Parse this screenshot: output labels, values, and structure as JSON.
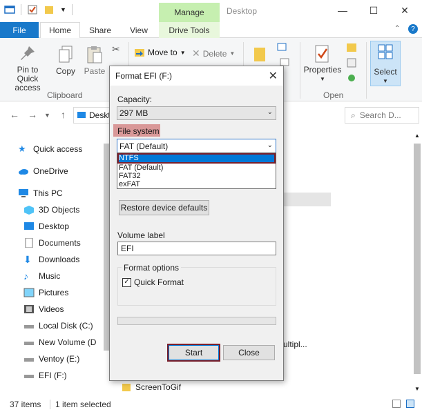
{
  "window": {
    "title": "Desktop",
    "manage_tab": "Manage",
    "minimize": "—",
    "maximize": "☐",
    "close": "✕"
  },
  "ribbon": {
    "tabs": [
      "File",
      "Home",
      "Share",
      "View",
      "Drive Tools"
    ],
    "buttons": {
      "pin": "Pin to Quick access",
      "copy": "Copy",
      "paste": "Paste",
      "move_to": "Move to",
      "delete": "Delete",
      "properties": "Properties",
      "select": "Select"
    },
    "groups": {
      "clipboard": "Clipboard",
      "open": "Open"
    }
  },
  "address": {
    "path": "Deskt",
    "search_placeholder": "Search D..."
  },
  "nav": {
    "items": [
      {
        "label": "Quick access",
        "icon": "star-icon"
      },
      {
        "label": "OneDrive",
        "icon": "cloud-icon"
      },
      {
        "label": "This PC",
        "icon": "computer-icon"
      },
      {
        "label": "3D Objects",
        "icon": "cube-icon"
      },
      {
        "label": "Desktop",
        "icon": "desktop-icon"
      },
      {
        "label": "Documents",
        "icon": "document-icon"
      },
      {
        "label": "Downloads",
        "icon": "download-icon"
      },
      {
        "label": "Music",
        "icon": "music-icon"
      },
      {
        "label": "Pictures",
        "icon": "picture-icon"
      },
      {
        "label": "Videos",
        "icon": "video-icon"
      },
      {
        "label": "Local Disk (C:)",
        "icon": "drive-icon"
      },
      {
        "label": "New Volume (D",
        "icon": "drive-icon"
      },
      {
        "label": "Ventoy (E:)",
        "icon": "drive-icon"
      },
      {
        "label": "EFI (F:)",
        "icon": "drive-icon"
      }
    ]
  },
  "content": {
    "partial_text": "ultipl...",
    "folder": "ScreenToGif"
  },
  "status": {
    "items": "37 items",
    "selected": "1 item selected"
  },
  "dialog": {
    "title": "Format EFI (F:)",
    "capacity_label": "Capacity:",
    "capacity_value": "297 MB",
    "fs_label": "File system",
    "fs_value": "FAT (Default)",
    "fs_options": [
      "NTFS",
      "FAT (Default)",
      "FAT32",
      "exFAT"
    ],
    "restore_button": "Restore device defaults",
    "volume_label": "Volume label",
    "volume_value": "EFI",
    "format_options_label": "Format options",
    "quick_format": "Quick Format",
    "quick_format_checked": true,
    "progress": 0,
    "start_button": "Start",
    "close_button": "Close"
  },
  "colors": {
    "accent": "#0078d7",
    "file_tab": "#1979ca",
    "manage_tab": "#c6efb0",
    "highlight_box": "#7b1f2b",
    "fs_label_highlight": "#d99898"
  }
}
